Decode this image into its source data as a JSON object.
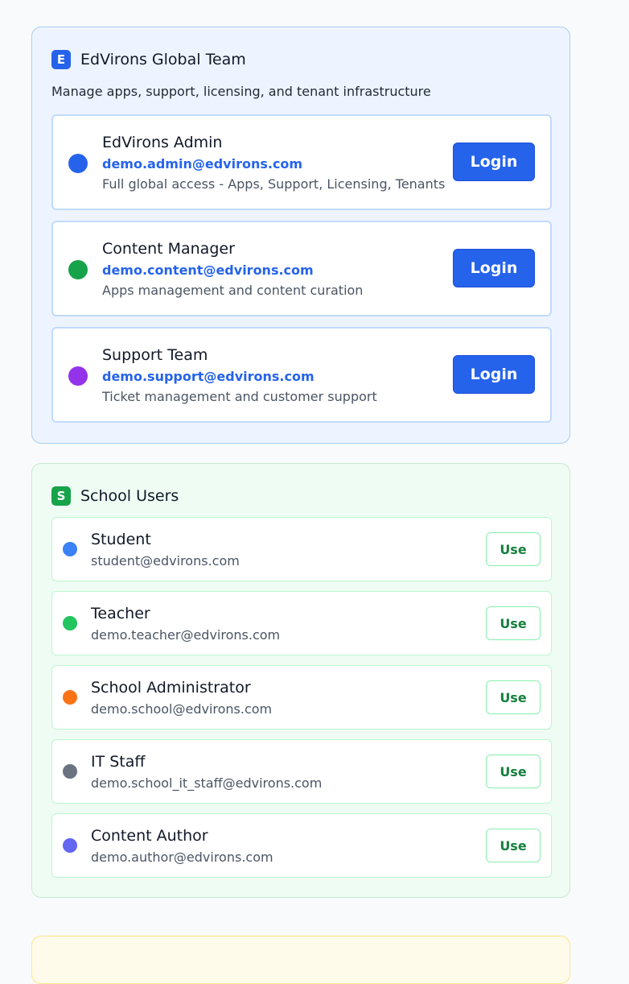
{
  "global_team": {
    "badge": "E",
    "title": "EdVirons Global Team",
    "subtitle": "Manage apps, support, licensing, and tenant infrastructure",
    "roles": [
      {
        "name": "EdVirons Admin",
        "email": "demo.admin@edvirons.com",
        "desc": "Full global access - Apps, Support, Licensing, Tenants",
        "color": "#2563eb",
        "button": "Login"
      },
      {
        "name": "Content Manager",
        "email": "demo.content@edvirons.com",
        "desc": "Apps management and content curation",
        "color": "#16a34a",
        "button": "Login"
      },
      {
        "name": "Support Team",
        "email": "demo.support@edvirons.com",
        "desc": "Ticket management and customer support",
        "color": "#9333ea",
        "button": "Login"
      }
    ]
  },
  "school_users": {
    "badge": "S",
    "title": "School Users",
    "users": [
      {
        "name": "Student",
        "email": "student@edvirons.com",
        "color": "#3b82f6",
        "button": "Use"
      },
      {
        "name": "Teacher",
        "email": "demo.teacher@edvirons.com",
        "color": "#22c55e",
        "button": "Use"
      },
      {
        "name": "School Administrator",
        "email": "demo.school@edvirons.com",
        "color": "#f97316",
        "button": "Use"
      },
      {
        "name": "IT Staff",
        "email": "demo.school_it_staff@edvirons.com",
        "color": "#6b7280",
        "button": "Use"
      },
      {
        "name": "Content Author",
        "email": "demo.author@edvirons.com",
        "color": "#6366f1",
        "button": "Use"
      }
    ]
  }
}
